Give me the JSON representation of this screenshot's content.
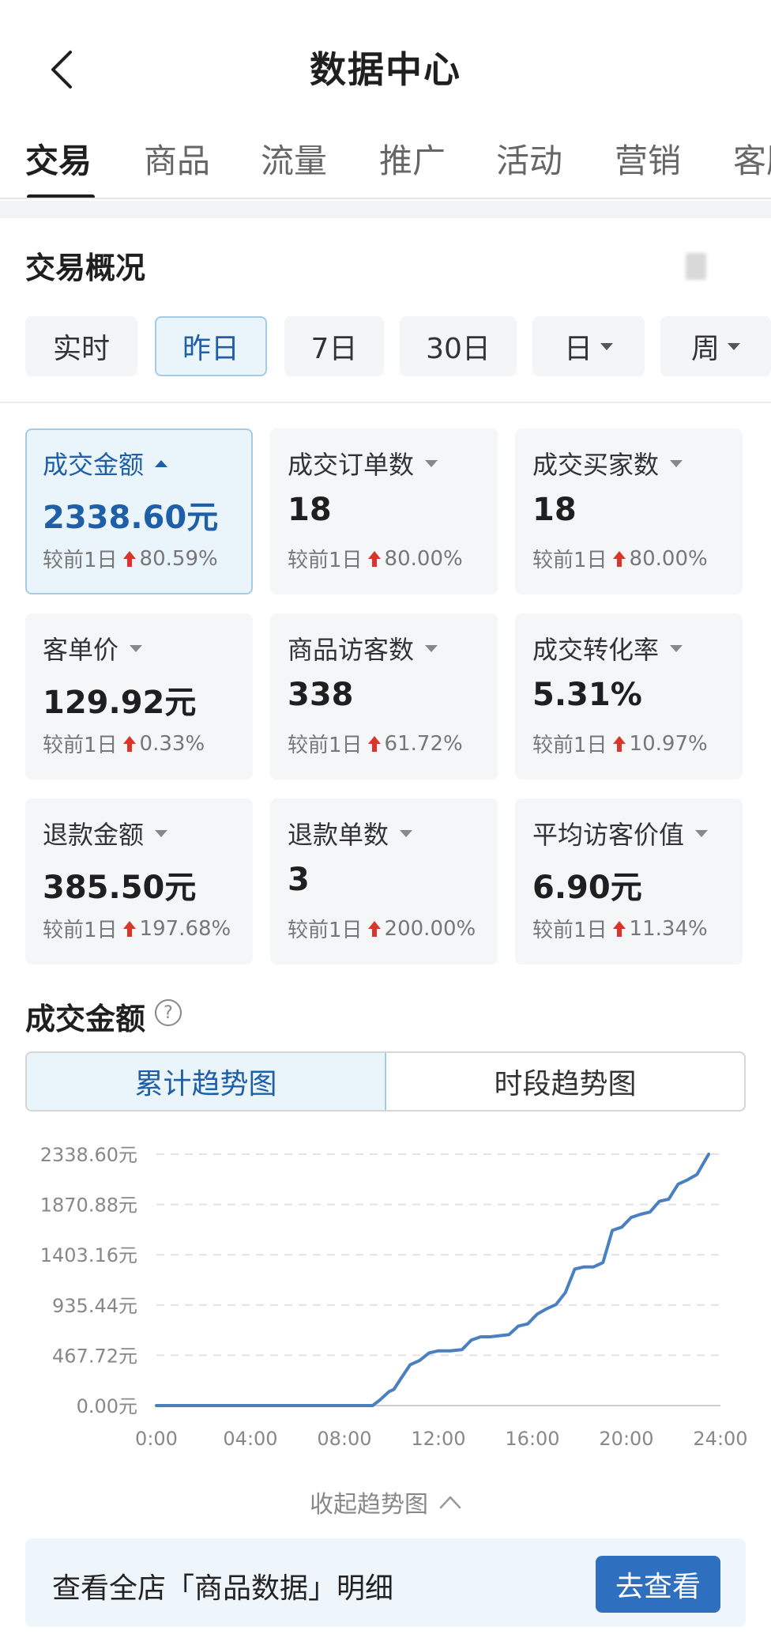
{
  "header": {
    "title": "数据中心"
  },
  "tabs": [
    "交易",
    "商品",
    "流量",
    "推广",
    "活动",
    "营销",
    "客服"
  ],
  "overview": {
    "title": "交易概况",
    "chips": [
      {
        "label": "实时"
      },
      {
        "label": "昨日",
        "active": true
      },
      {
        "label": "7日"
      },
      {
        "label": "30日"
      },
      {
        "label": "日",
        "dropdown": true
      },
      {
        "label": "周",
        "dropdown": true
      }
    ]
  },
  "metrics": [
    {
      "label": "成交金额",
      "value": "2338.60元",
      "compare_prefix": "较前1日",
      "change": "80.59%",
      "active": true
    },
    {
      "label": "成交订单数",
      "value": "18",
      "compare_prefix": "较前1日",
      "change": "80.00%"
    },
    {
      "label": "成交买家数",
      "value": "18",
      "compare_prefix": "较前1日",
      "change": "80.00%"
    },
    {
      "label": "客单价",
      "value": "129.92元",
      "compare_prefix": "较前1日",
      "change": "0.33%"
    },
    {
      "label": "商品访客数",
      "value": "338",
      "compare_prefix": "较前1日",
      "change": "61.72%"
    },
    {
      "label": "成交转化率",
      "value": "5.31%",
      "compare_prefix": "较前1日",
      "change": "10.97%"
    },
    {
      "label": "退款金额",
      "value": "385.50元",
      "compare_prefix": "较前1日",
      "change": "197.68%"
    },
    {
      "label": "退款单数",
      "value": "3",
      "compare_prefix": "较前1日",
      "change": "200.00%"
    },
    {
      "label": "平均访客价值",
      "value": "6.90元",
      "compare_prefix": "较前1日",
      "change": "11.34%"
    }
  ],
  "colors": {
    "accent": "#1f5fa8",
    "up_arrow": "#d9362b",
    "line": "#4a7fc0",
    "button": "#2f6fbf"
  },
  "trend": {
    "title": "成交金额",
    "info_icon": "?",
    "toggle": [
      "累计趋势图",
      "时段趋势图"
    ],
    "collapse_label": "收起趋势图"
  },
  "chart_data": {
    "type": "line",
    "y_ticks": [
      "2338.60元",
      "1870.88元",
      "1403.16元",
      "935.44元",
      "467.72元",
      "0.00元"
    ],
    "x_ticks": [
      "0:00",
      "04:00",
      "08:00",
      "12:00",
      "16:00",
      "20:00",
      "24:00"
    ],
    "ylim": [
      0,
      2338.6
    ],
    "xlim": [
      0,
      24
    ],
    "grid": true,
    "series": [
      {
        "x": [
          0,
          9.2,
          9.5,
          9.9,
          10.1,
          10.4,
          10.8,
          11.2,
          11.6,
          12.0,
          12.5,
          13.0,
          13.4,
          13.8,
          14.2,
          14.6,
          15.0,
          15.4,
          15.8,
          16.2,
          16.6,
          17.0,
          17.4,
          17.8,
          18.2,
          18.6,
          19.0,
          19.4,
          19.8,
          20.2,
          20.6,
          21.0,
          21.4,
          21.8,
          22.2,
          22.6,
          23.0,
          23.5
        ],
        "y": [
          0,
          0,
          50,
          130,
          150,
          250,
          380,
          420,
          490,
          510,
          510,
          520,
          610,
          640,
          640,
          650,
          660,
          740,
          760,
          850,
          900,
          940,
          1050,
          1270,
          1290,
          1290,
          1330,
          1630,
          1660,
          1750,
          1780,
          1800,
          1900,
          1920,
          2060,
          2100,
          2150,
          2338.6
        ]
      }
    ]
  },
  "banner": {
    "text": "查看全店「商品数据」明细",
    "button": "去查看"
  }
}
